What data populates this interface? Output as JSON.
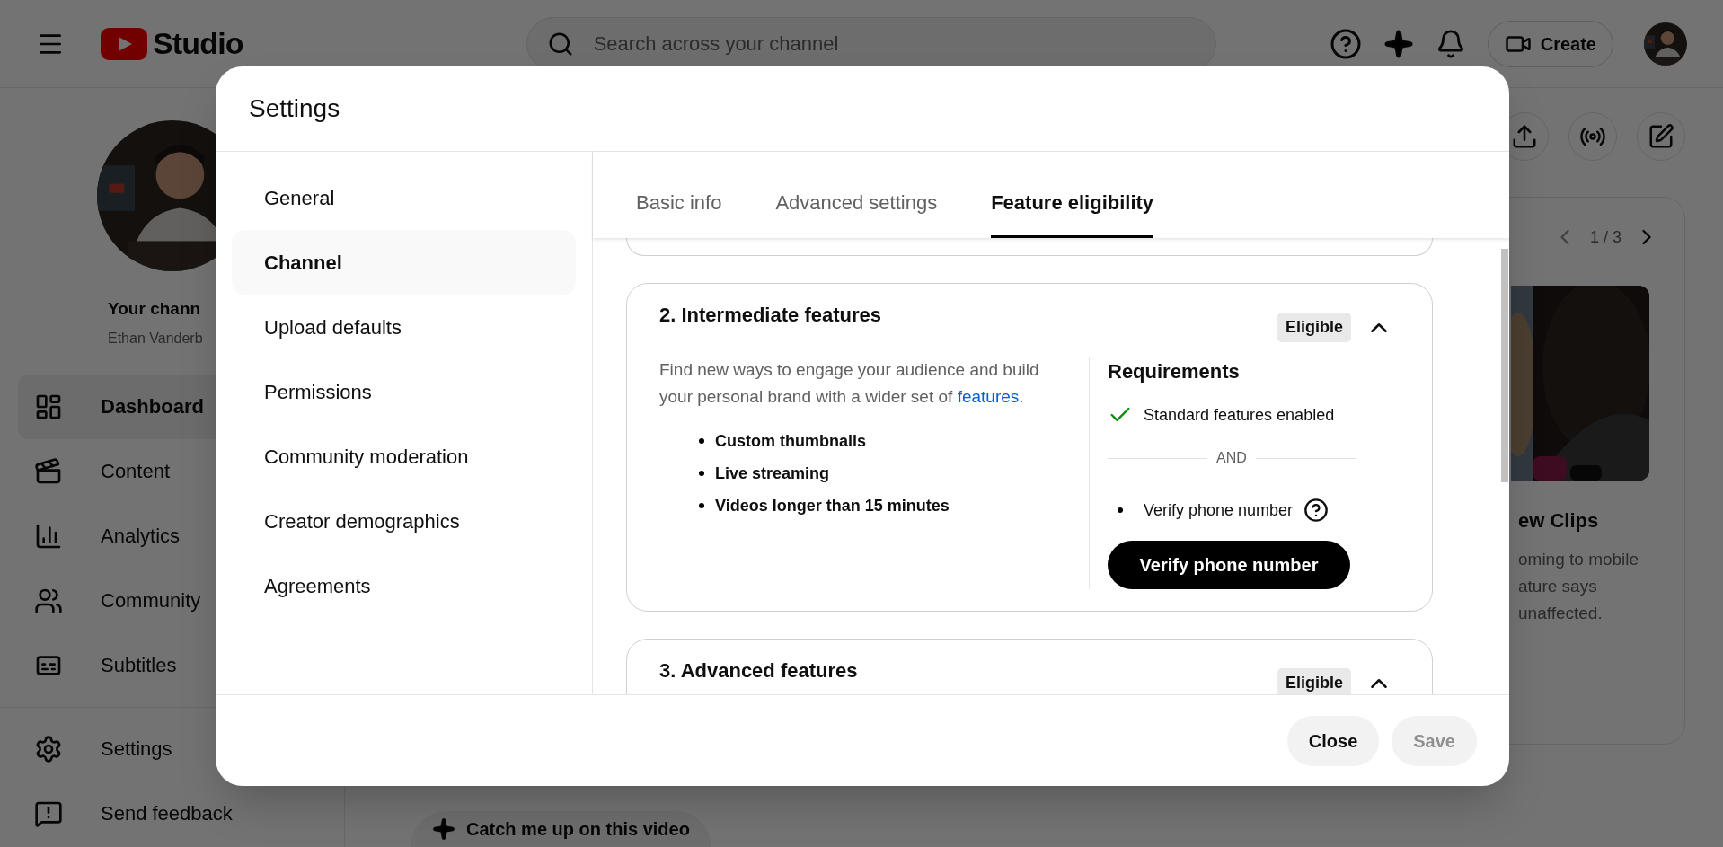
{
  "topbar": {
    "logo_text": "Studio",
    "search": {
      "placeholder": "Search across your channel"
    },
    "create": "Create"
  },
  "sidebar": {
    "channel": {
      "title": "Your chann",
      "name": "Ethan Vanderb"
    },
    "items": [
      {
        "label": "Dashboard",
        "selected": true
      },
      {
        "label": "Content",
        "selected": false
      },
      {
        "label": "Analytics",
        "selected": false
      },
      {
        "label": "Community",
        "selected": false
      },
      {
        "label": "Subtitles",
        "selected": false
      }
    ],
    "bottom_items": [
      {
        "label": "Settings"
      },
      {
        "label": "Send feedback"
      }
    ]
  },
  "right_panel": {
    "pager": "1 / 3",
    "title": "ew Clips",
    "lines": [
      "oming to mobile",
      "ature says",
      "unaffected."
    ]
  },
  "bottom": {
    "catch_up": "Catch me up on this video"
  },
  "modal": {
    "title": "Settings",
    "nav": [
      {
        "label": "General",
        "selected": false
      },
      {
        "label": "Channel",
        "selected": true
      },
      {
        "label": "Upload defaults",
        "selected": false
      },
      {
        "label": "Permissions",
        "selected": false
      },
      {
        "label": "Community moderation",
        "selected": false
      },
      {
        "label": "Creator demographics",
        "selected": false
      },
      {
        "label": "Agreements",
        "selected": false
      }
    ],
    "tabs": [
      {
        "label": "Basic info",
        "selected": false
      },
      {
        "label": "Advanced settings",
        "selected": false
      },
      {
        "label": "Feature eligibility",
        "selected": true
      }
    ],
    "sections": [
      {
        "title": "2. Intermediate features",
        "badge": "Eligible",
        "expanded": true,
        "description": {
          "text": "Find new ways to engage your audience and build your personal brand with a wider set of ",
          "link": "features",
          "end": "."
        },
        "bullets": [
          "Custom thumbnails",
          "Live streaming",
          "Videos longer than 15 minutes"
        ],
        "requirements": {
          "title": "Requirements",
          "separator": "AND",
          "button": "Verify phone number",
          "items": [
            {
              "label": "Standard features enabled",
              "met": true,
              "help": false
            },
            {
              "label": "Verify phone number",
              "met": false,
              "help": true
            }
          ]
        }
      },
      {
        "title": "3. Advanced features",
        "badge": "Eligible",
        "expanded": true
      }
    ],
    "buttons": [
      {
        "label": "Close",
        "disabled": false
      },
      {
        "label": "Save",
        "disabled": true
      }
    ]
  }
}
